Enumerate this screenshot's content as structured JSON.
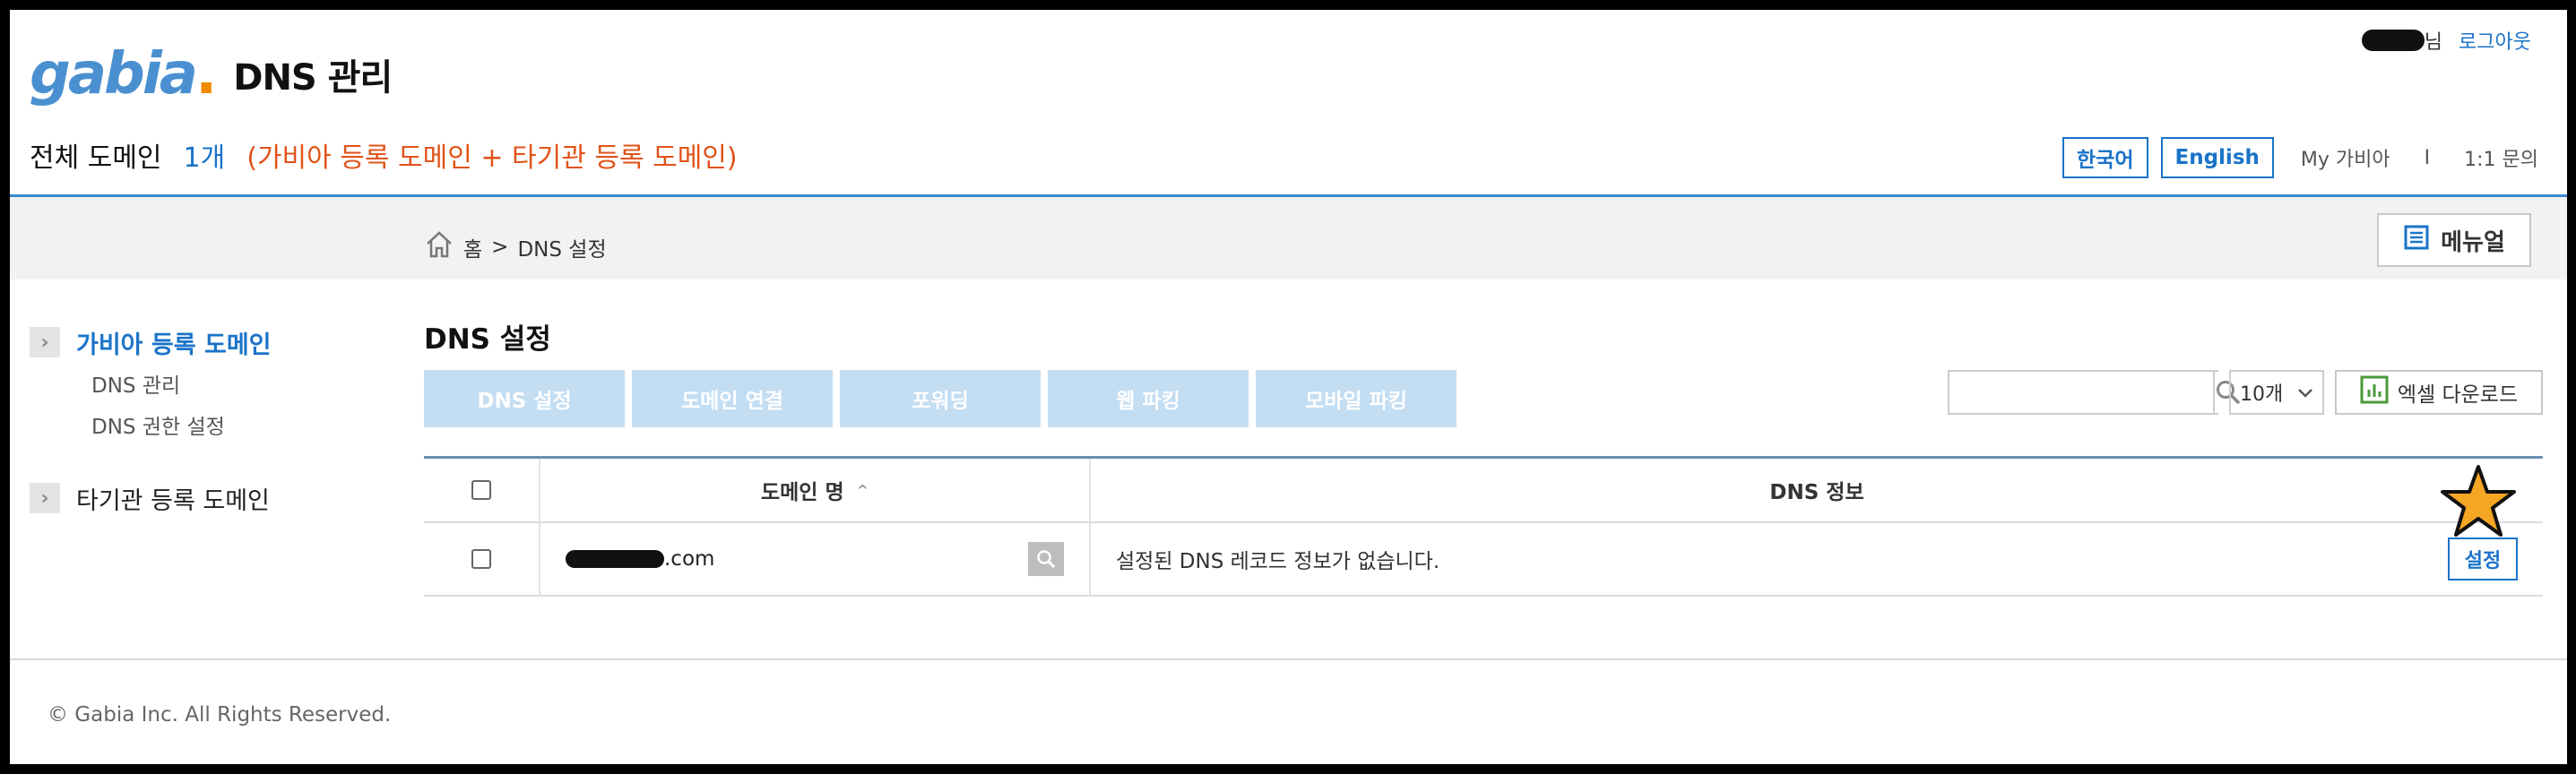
{
  "header": {
    "logo_text": "gabia",
    "logo_dot": ".",
    "title": "DNS 관리",
    "user_suffix": "님",
    "logout": "로그아웃"
  },
  "summary": {
    "label": "전체 도메인",
    "count": "1개",
    "description": "(가비아 등록 도메인 + 타기관 등록 도메인)"
  },
  "top_links": {
    "lang_korean": "한국어",
    "lang_english": "English",
    "my_gabia": "My 가비아",
    "separator": "I",
    "inquiry": "1:1 문의"
  },
  "breadcrumb": {
    "home": "홈",
    "separator": ">",
    "current": "DNS 설정"
  },
  "manual_button": "메뉴얼",
  "sidebar": {
    "groups": [
      {
        "label": "가비아 등록 도메인",
        "items": [
          "DNS 관리",
          "DNS 권한 설정"
        ]
      },
      {
        "label": "타기관 등록 도메인",
        "items": []
      }
    ]
  },
  "main": {
    "title": "DNS 설정",
    "tabs": [
      "DNS 설정",
      "도메인 연결",
      "포워딩",
      "웹 파킹",
      "모바일 파킹"
    ],
    "search_placeholder": "",
    "page_size": "10개",
    "excel_button": "엑셀 다운로드"
  },
  "table": {
    "headers": {
      "domain": "도메인 명",
      "info": "DNS 정보"
    },
    "rows": [
      {
        "domain_suffix": ".com",
        "info": "설정된 DNS 레코드 정보가 없습니다.",
        "action": "설정"
      }
    ]
  },
  "footer": "© Gabia Inc. All Rights Reserved.",
  "colors": {
    "accent": "#1a73c8",
    "highlight": "#e0531a",
    "tab_bg": "#c3ddf2",
    "star": "#f5a623"
  }
}
